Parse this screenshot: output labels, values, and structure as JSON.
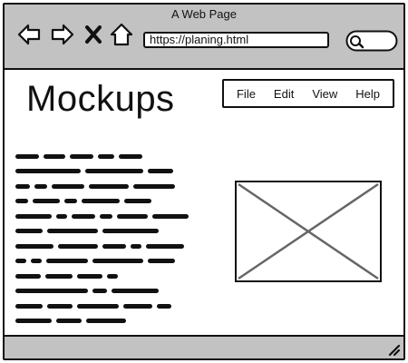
{
  "window": {
    "title": "A Web Page"
  },
  "toolbar": {
    "icons": [
      "back-arrow-icon",
      "forward-arrow-icon",
      "close-x-icon",
      "home-icon",
      "search-icon"
    ],
    "address_value": "https://planing.html"
  },
  "page": {
    "title": "Mockups",
    "menu": [
      "File",
      "Edit",
      "View",
      "Help"
    ],
    "body_placeholder_lines": 12,
    "image": "image-placeholder-icon"
  },
  "colors": {
    "chrome": "#c2c2c2",
    "stroke": "#111111",
    "placeholder_x": "#666666"
  }
}
